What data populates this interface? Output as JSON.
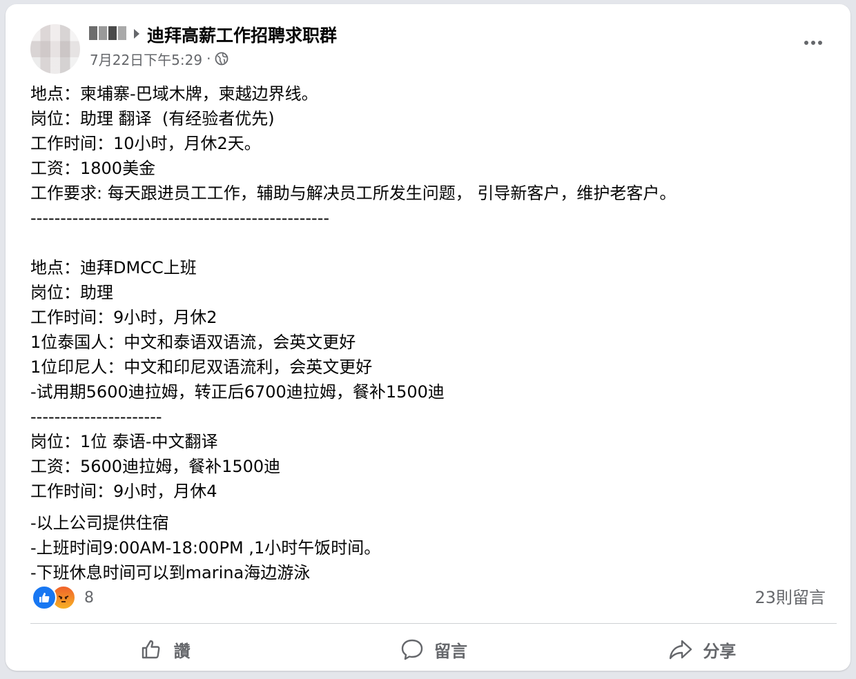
{
  "post": {
    "group_name": "迪拜高薪工作招聘求职群",
    "timestamp": "7月22日下午5:29",
    "separator": "·",
    "privacy_icon": "globe-icon",
    "lines": [
      "地点：柬埔寨-巴域木牌，柬越边界线。",
      "岗位：助理 翻译  (有经验者优先)",
      "工作时间：10小时，月休2天。",
      "工资：1800美金",
      "工作要求: 每天跟进员工工作，辅助与解决员工所发生问题， 引导新客户，维护老客户。",
      "--------------------------------------------------",
      "",
      "地点：迪拜DMCC上班",
      "岗位：助理",
      "工作时间：9小时，月休2",
      "1位泰国人：中文和泰语双语流，会英文更好",
      "1位印尼人：中文和印尼双语流利，会英文更好",
      "-试用期5600迪拉姆，转正后6700迪拉姆，餐补1500迪",
      "----------------------",
      "岗位：1位 泰语-中文翻译",
      "工资：5600迪拉姆，餐补1500迪",
      "工作时间：9小时，月休4"
    ],
    "lines_after": [
      "-以上公司提供住宿",
      "-上班时间9:00AM-18:00PM ,1小时午饭时间。",
      "-下班休息时间可以到marina海边游泳"
    ]
  },
  "reactions": {
    "count": "8",
    "icons": [
      "like-icon",
      "angry-icon"
    ]
  },
  "comments_label": "23則留言",
  "actions": {
    "like_label": "讚",
    "comment_label": "留言",
    "share_label": "分享"
  },
  "colors": {
    "background": "#e4e6eb",
    "card": "#ffffff",
    "secondary_text": "#65676b",
    "like_blue": "#1877f2"
  }
}
